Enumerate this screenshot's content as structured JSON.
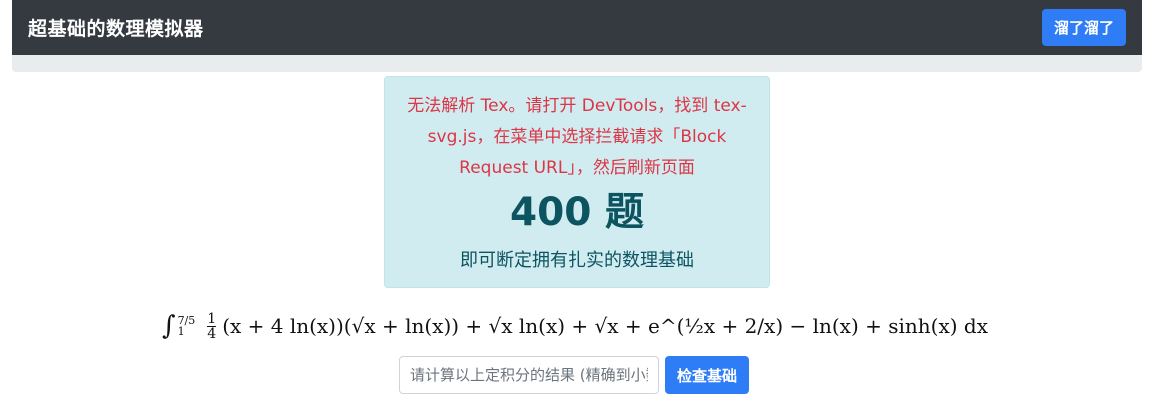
{
  "navbar": {
    "title": "超基础的数理模拟器",
    "action_label": "溜了溜了"
  },
  "alert": {
    "error_text": "无法解析 Tex。请打开 DevTools，找到 tex-svg.js，在菜单中选择拦截请求「Block Request URL」，然后刷新页面",
    "count_text": "400 题",
    "subtitle": "即可断定拥有扎实的数理基础"
  },
  "problem": {
    "int_symbol": "∫",
    "upper_limit": "7/5",
    "lower_limit": "1",
    "coef_num": "1",
    "coef_den": "4",
    "integrand": "(x + 4 ln(x))(√x + ln(x)) + √x ln(x) + √x + e^(½x + 2/x) − ln(x) + sinh(x) dx"
  },
  "answer": {
    "placeholder": "请计算以上定积分的结果 (精确到小数点后两位)",
    "value": ""
  },
  "check_button": {
    "label": "检查基础"
  }
}
